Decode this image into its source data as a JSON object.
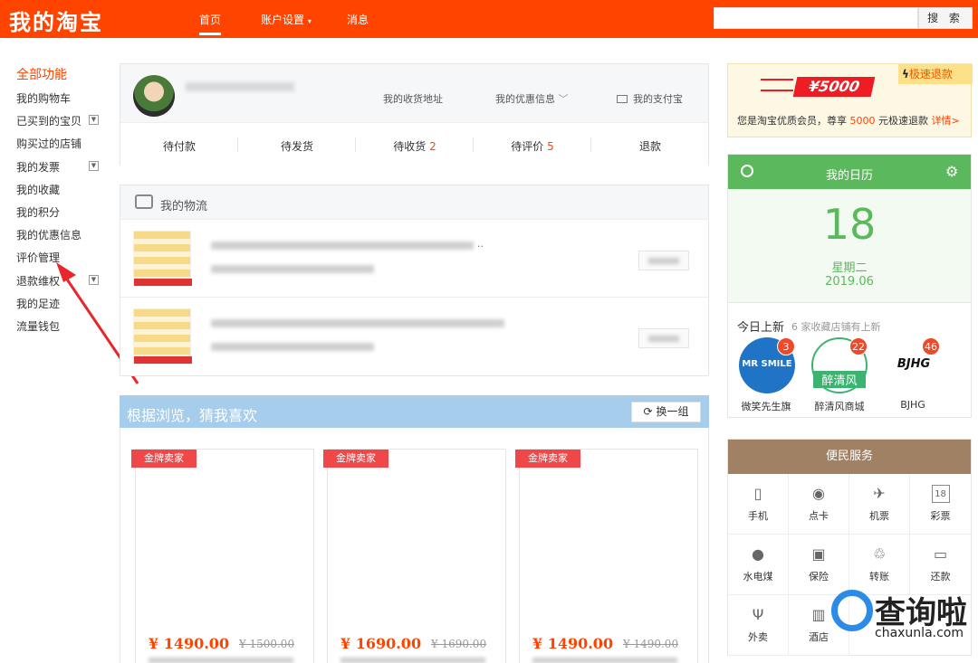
{
  "header": {
    "brand": "我的淘宝",
    "nav": [
      "首页",
      "账户设置",
      "消息"
    ],
    "search_button": "搜 索",
    "search_placeholder": ""
  },
  "sidebar": {
    "title": "全部功能",
    "items": [
      {
        "label": "我的购物车",
        "dropdown": false
      },
      {
        "label": "已买到的宝贝",
        "dropdown": true
      },
      {
        "label": "购买过的店铺",
        "dropdown": false
      },
      {
        "label": "我的发票",
        "dropdown": true
      },
      {
        "label": "我的收藏",
        "dropdown": false
      },
      {
        "label": "我的积分",
        "dropdown": false
      },
      {
        "label": "我的优惠信息",
        "dropdown": false
      },
      {
        "label": "评价管理",
        "dropdown": false
      },
      {
        "label": "退款维权",
        "dropdown": true
      },
      {
        "label": "我的足迹",
        "dropdown": false
      },
      {
        "label": "流量钱包",
        "dropdown": false
      }
    ]
  },
  "profile": {
    "address_link": "我的收货地址",
    "coupon_link": "我的优惠信息",
    "alipay_link": "我的支付宝",
    "orders": [
      {
        "label": "待付款",
        "count": ""
      },
      {
        "label": "待发货",
        "count": ""
      },
      {
        "label": "待收货",
        "count": "2"
      },
      {
        "label": "待评价",
        "count": "5"
      },
      {
        "label": "退款",
        "count": ""
      }
    ]
  },
  "logistics": {
    "title": "我的物流",
    "ellipsis": ".."
  },
  "guess": {
    "title": "根据浏览，猜我喜欢",
    "refresh": "换一组",
    "products": [
      {
        "tag": "金牌卖家",
        "price": "¥ 1490.00",
        "old_price": "¥ 1500.00"
      },
      {
        "tag": "金牌卖家",
        "price": "¥ 1690.00",
        "old_price": "¥ 1690.00"
      },
      {
        "tag": "金牌卖家",
        "price": "¥ 1490.00",
        "old_price": "¥ 1490.00"
      }
    ]
  },
  "vip": {
    "amount": "¥5000",
    "badge": "极速退款",
    "text_before": "您是淘宝优质会员，尊享 ",
    "text_amount": "5000",
    "text_after": " 元极速退款 ",
    "detail_link": "详情>"
  },
  "calendar": {
    "title": "我的日历",
    "day": "18",
    "weekday": "星期二",
    "month": "2019.06",
    "new_title": "今日上新",
    "new_sub": "6 家收藏店铺有上新",
    "shops": [
      {
        "name": "微笑先生旗",
        "badge": "3",
        "logo_text": "MR SMILE"
      },
      {
        "name": "醉清风商城",
        "badge": "22",
        "logo_text": "醉清风"
      },
      {
        "name": "BJHG",
        "badge": "46",
        "logo_text": "BJHG"
      }
    ]
  },
  "service": {
    "title": "便民服务",
    "items": [
      {
        "label": "手机",
        "icon": "phone-icon"
      },
      {
        "label": "点卡",
        "icon": "gamepad-icon"
      },
      {
        "label": "机票",
        "icon": "plane-icon"
      },
      {
        "label": "彩票",
        "icon": "lottery-icon",
        "glyph": "18"
      },
      {
        "label": "水电煤",
        "icon": "water-drop-icon"
      },
      {
        "label": "保险",
        "icon": "insurance-icon"
      },
      {
        "label": "转账",
        "icon": "transfer-icon"
      },
      {
        "label": "还款",
        "icon": "card-icon"
      },
      {
        "label": "外卖",
        "icon": "fork-icon"
      },
      {
        "label": "酒店",
        "icon": "hotel-icon"
      }
    ]
  },
  "watermark": {
    "text": "查询啦",
    "url": "chaxunla.com"
  },
  "colors": {
    "brand": "#ff4400",
    "calendar_green": "#5cb85c",
    "guess_blue": "#a7cdec",
    "service_brown": "#a08163",
    "gold_tag": "#f04848"
  }
}
